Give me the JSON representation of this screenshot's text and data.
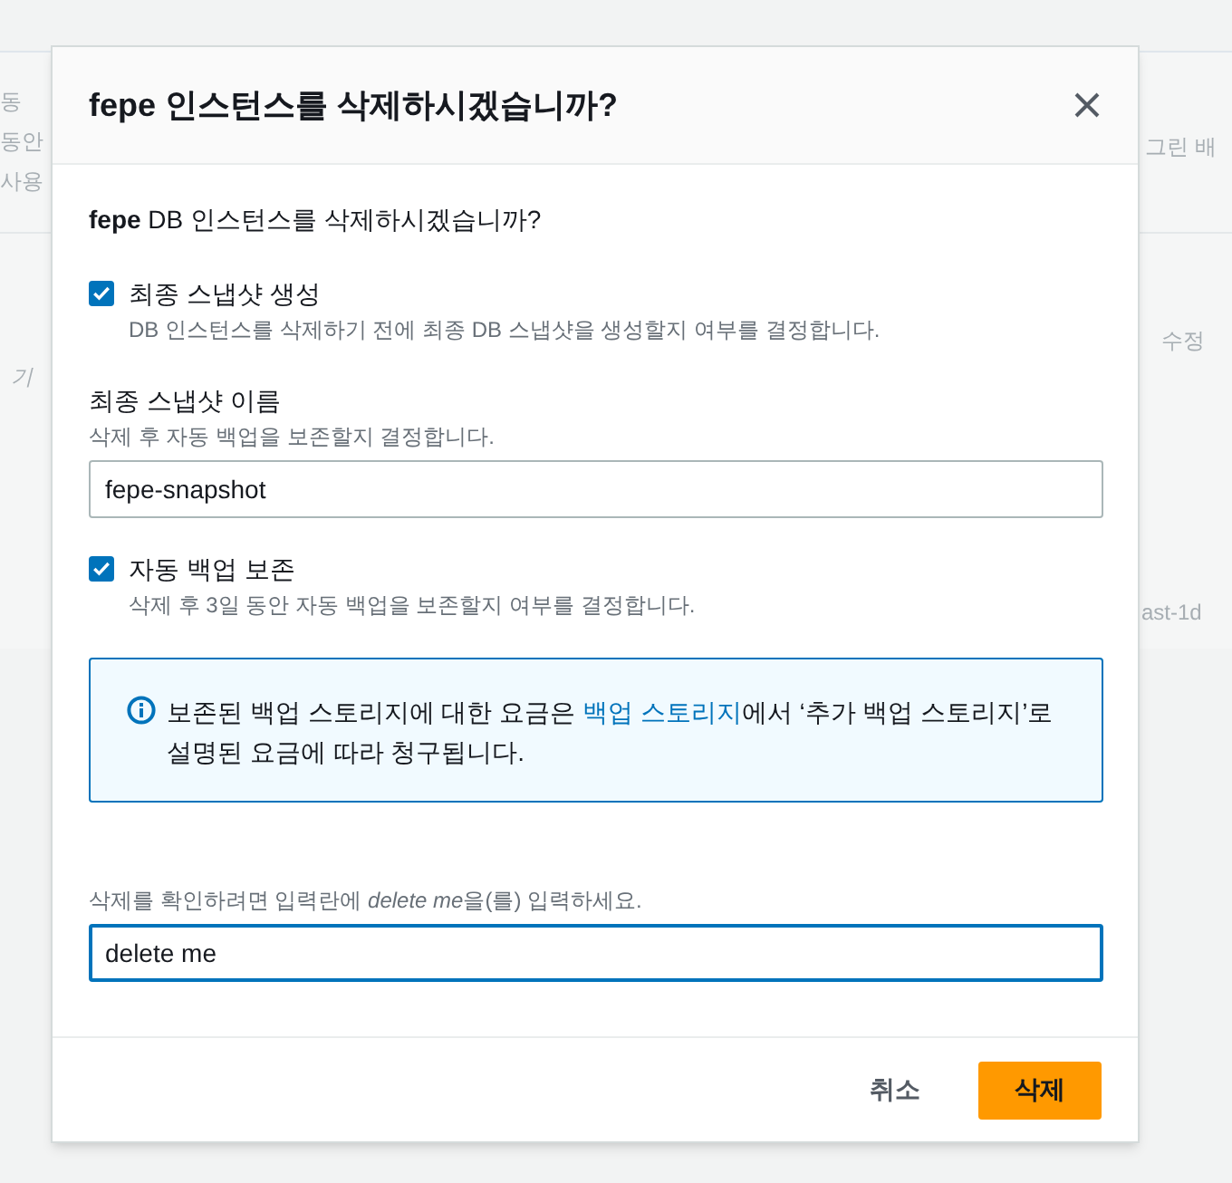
{
  "background": {
    "left_fragments": [
      "동",
      "동안",
      "사용",
      "기"
    ],
    "right_fragments": [
      "그린 배",
      "수정",
      "ast-1d"
    ]
  },
  "dialog": {
    "title": "fepe 인스턴스를 삭제하시겠습니까?",
    "question": "**fepe** DB 인스턴스를 삭제하시겠습니까?",
    "final_snapshot": {
      "label": "최종 스냅샷 생성",
      "description": "DB 인스턴스를 삭제하기 전에 최종 DB 스냅샷을 생성할지 여부를 결정합니다.",
      "checked": true
    },
    "snapshot_name": {
      "label": "최종 스냅샷 이름",
      "description": "삭제 후 자동 백업을 보존할지 결정합니다.",
      "value": "fepe-snapshot"
    },
    "retain_backups": {
      "label": "자동 백업 보존",
      "description": "삭제 후 3일 동안 자동 백업을 보존할지 여부를 결정합니다.",
      "checked": true
    },
    "info": {
      "before": "보존된 백업 스토리지에 대한 요금은 ",
      "link": "백업 스토리지",
      "after": "에서 ‘추가 백업 스토리지’로 설명된 요금에 따라 청구됩니다."
    },
    "confirm": {
      "label_before": "삭제를 확인하려면 입력란에 ",
      "label_emphasis": "delete me",
      "label_after": "을(를) 입력하세요.",
      "value": "delete me"
    },
    "buttons": [
      {
        "label": "취소",
        "kind": "link"
      },
      {
        "label": "삭제",
        "kind": "primary"
      }
    ]
  }
}
